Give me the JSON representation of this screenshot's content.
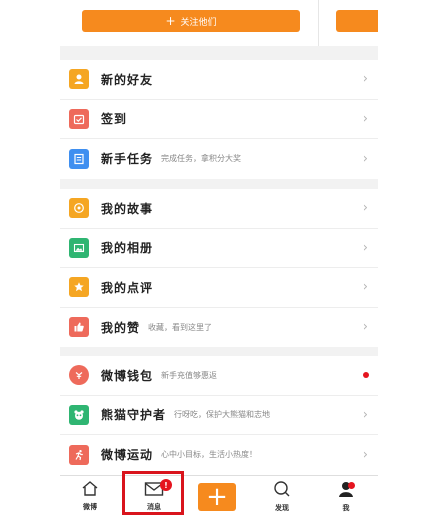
{
  "top_card": {
    "follow_label": "关注他们"
  },
  "groups": [
    {
      "items": [
        {
          "title": "新的好友",
          "subtitle": "",
          "icon": "contact-icon",
          "color": "#f5a623"
        },
        {
          "title": "签到",
          "subtitle": "",
          "icon": "calendar-check-icon",
          "color": "#ee6a5b"
        },
        {
          "title": "新手任务",
          "subtitle": "完成任务，拿积分大奖",
          "icon": "task-list-icon",
          "color": "#3f8ff0"
        }
      ]
    },
    {
      "items": [
        {
          "title": "我的故事",
          "subtitle": "",
          "icon": "story-icon",
          "color": "#f5a623"
        },
        {
          "title": "我的相册",
          "subtitle": "",
          "icon": "photo-icon",
          "color": "#2fb572"
        },
        {
          "title": "我的点评",
          "subtitle": "",
          "icon": "star-review-icon",
          "color": "#f5a623"
        },
        {
          "title": "我的赞",
          "subtitle": "收藏，看到这里了",
          "icon": "thumbs-up-icon",
          "color": "#ee6a5b"
        }
      ]
    },
    {
      "items": [
        {
          "title": "微博钱包",
          "subtitle": "新手充值够惠返",
          "icon": "wallet-icon",
          "color": "#ee6a5b",
          "dot": true
        },
        {
          "title": "熊猫守护者",
          "subtitle": "行呀吃，保护大熊猫和志地",
          "icon": "panda-icon",
          "color": "#2fb572"
        },
        {
          "title": "微博运动",
          "subtitle": "心中小目标，生活小热度！",
          "icon": "runner-icon",
          "color": "#ee6a5b"
        }
      ]
    }
  ],
  "tabbar": {
    "home_label": "微博",
    "messages_label": "消息",
    "messages_badge": "!",
    "discover_label": "发现",
    "me_label": "我"
  }
}
